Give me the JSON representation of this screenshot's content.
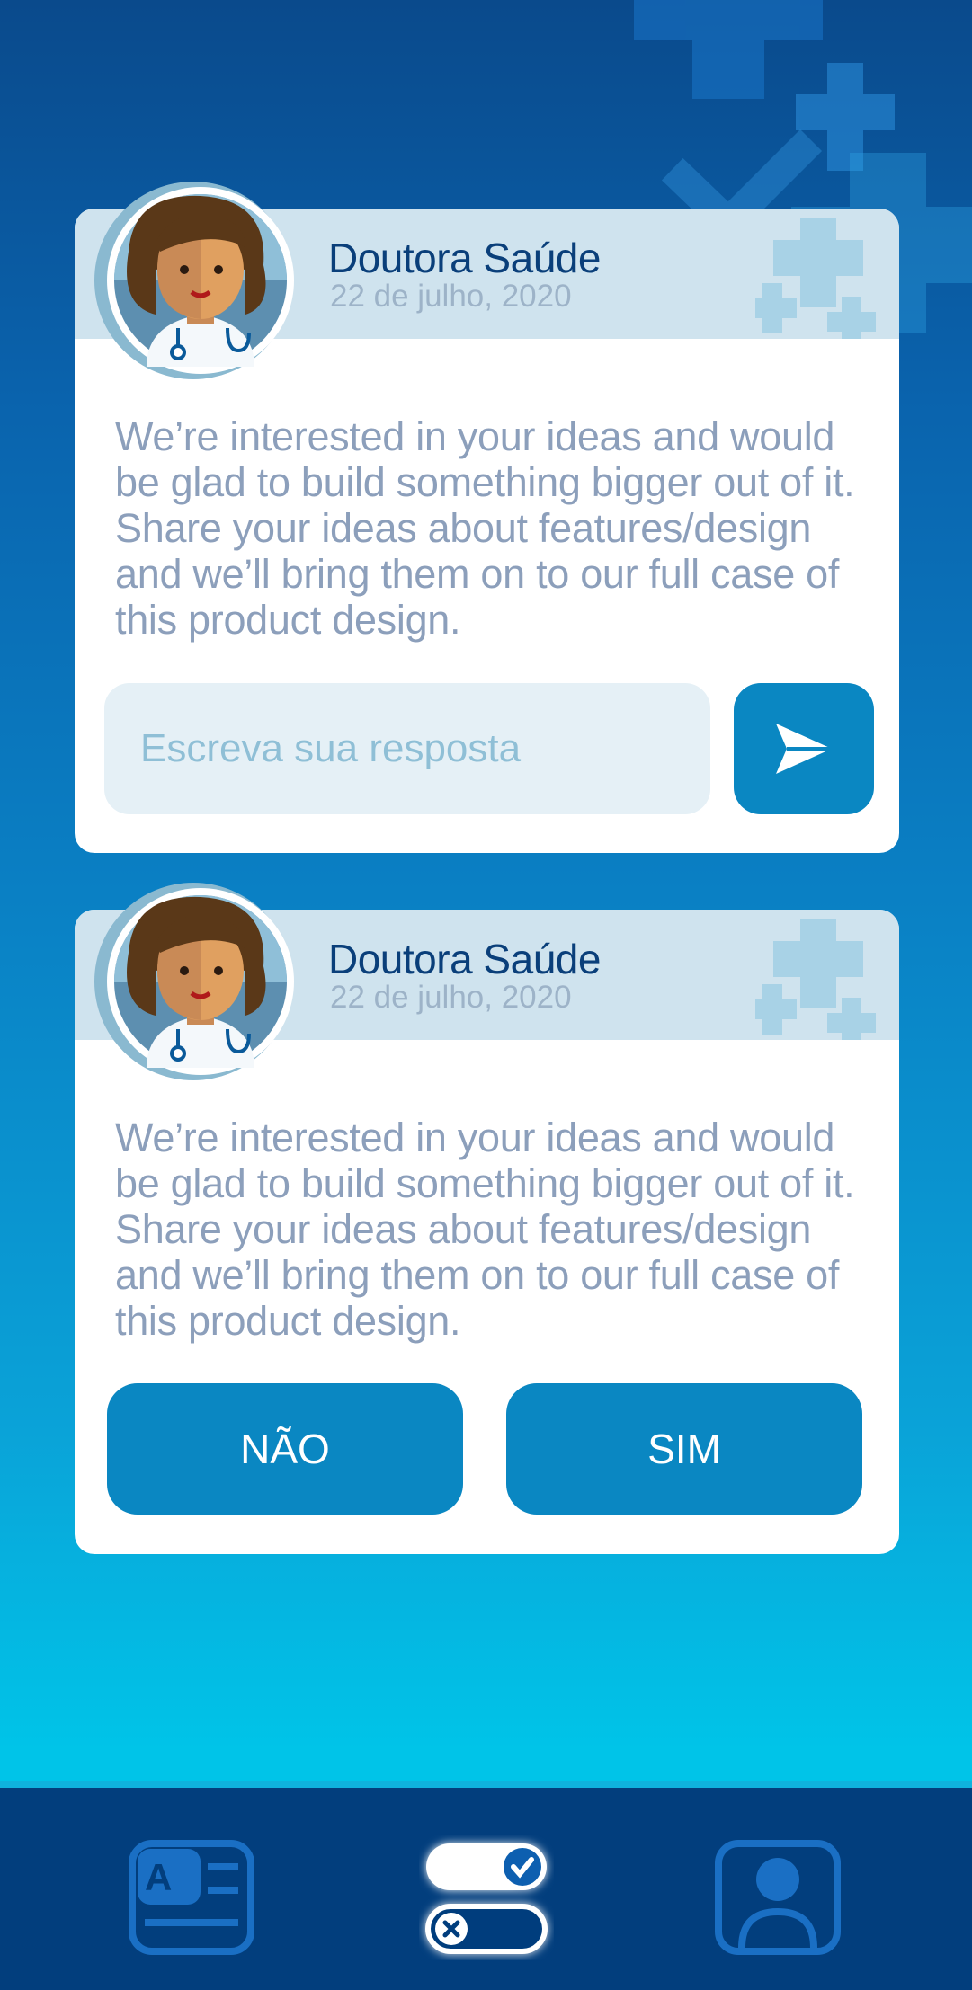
{
  "colors": {
    "bg_top": "#0a4a8c",
    "bg_bottom": "#00c8ea",
    "card_header": "#cfe3ee",
    "accent_button": "#0a87c2",
    "name_text": "#0a3f7a",
    "date_text": "#9db3c8",
    "message_text": "#8c9fbb",
    "nav_bar": "#023e7d"
  },
  "cards": [
    {
      "author": "Doutora Saúde",
      "date": "22 de julho, 2020",
      "message": "We’re interested in your ideas and would be glad to build something bigger out of it. Share your ideas about features/design and we’ll bring them on to our full case of this product design.",
      "reply_placeholder": "Escreva sua resposta",
      "send_icon": "send-icon"
    },
    {
      "author": "Doutora Saúde",
      "date": "22 de julho, 2020",
      "message": "We’re interested in your ideas and would be glad to build something bigger out of it. Share your ideas about features/design and we’ll bring them on to our full case of this product design.",
      "no_label": "NÃO",
      "yes_label": "SIM"
    }
  ],
  "bottom_nav": {
    "items": [
      {
        "icon": "news-icon",
        "active": false
      },
      {
        "icon": "toggles-icon",
        "active": true
      },
      {
        "icon": "profile-icon",
        "active": false
      }
    ]
  }
}
